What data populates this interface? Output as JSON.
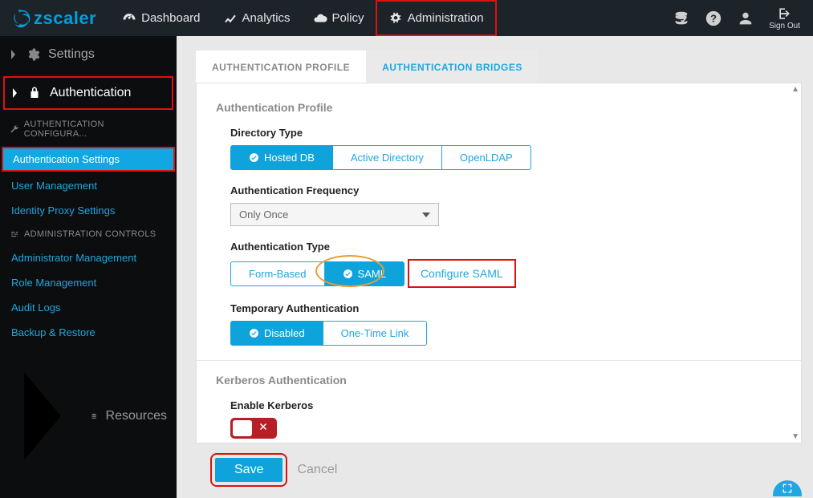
{
  "brand": "zscaler",
  "topnav": {
    "dashboard": "Dashboard",
    "analytics": "Analytics",
    "policy": "Policy",
    "administration": "Administration"
  },
  "signout_label": "Sign Out",
  "sidebar": {
    "settings": "Settings",
    "authentication": "Authentication",
    "auth_config_header": "AUTHENTICATION CONFIGURA...",
    "items": {
      "auth_settings": "Authentication Settings",
      "user_management": "User Management",
      "identity_proxy": "Identity Proxy Settings"
    },
    "admin_controls_header": "ADMINISTRATION CONTROLS",
    "admin_items": {
      "administrator_management": "Administrator Management",
      "role_management": "Role Management",
      "audit_logs": "Audit Logs",
      "backup_restore": "Backup & Restore"
    },
    "resources": "Resources"
  },
  "tabs": {
    "profile": "AUTHENTICATION PROFILE",
    "bridges": "AUTHENTICATION BRIDGES"
  },
  "panel": {
    "title": "Authentication Profile",
    "directory_type": {
      "label": "Directory Type",
      "hosted_db": "Hosted DB",
      "active_directory": "Active Directory",
      "openldap": "OpenLDAP"
    },
    "auth_frequency": {
      "label": "Authentication Frequency",
      "value": "Only Once"
    },
    "auth_type": {
      "label": "Authentication Type",
      "form_based": "Form-Based",
      "saml": "SAML",
      "configure_saml": "Configure SAML"
    },
    "temp_auth": {
      "label": "Temporary Authentication",
      "disabled": "Disabled",
      "one_time_link": "One-Time Link"
    },
    "kerberos": {
      "title": "Kerberos Authentication",
      "enable_label": "Enable Kerberos"
    }
  },
  "footer": {
    "save": "Save",
    "cancel": "Cancel"
  }
}
